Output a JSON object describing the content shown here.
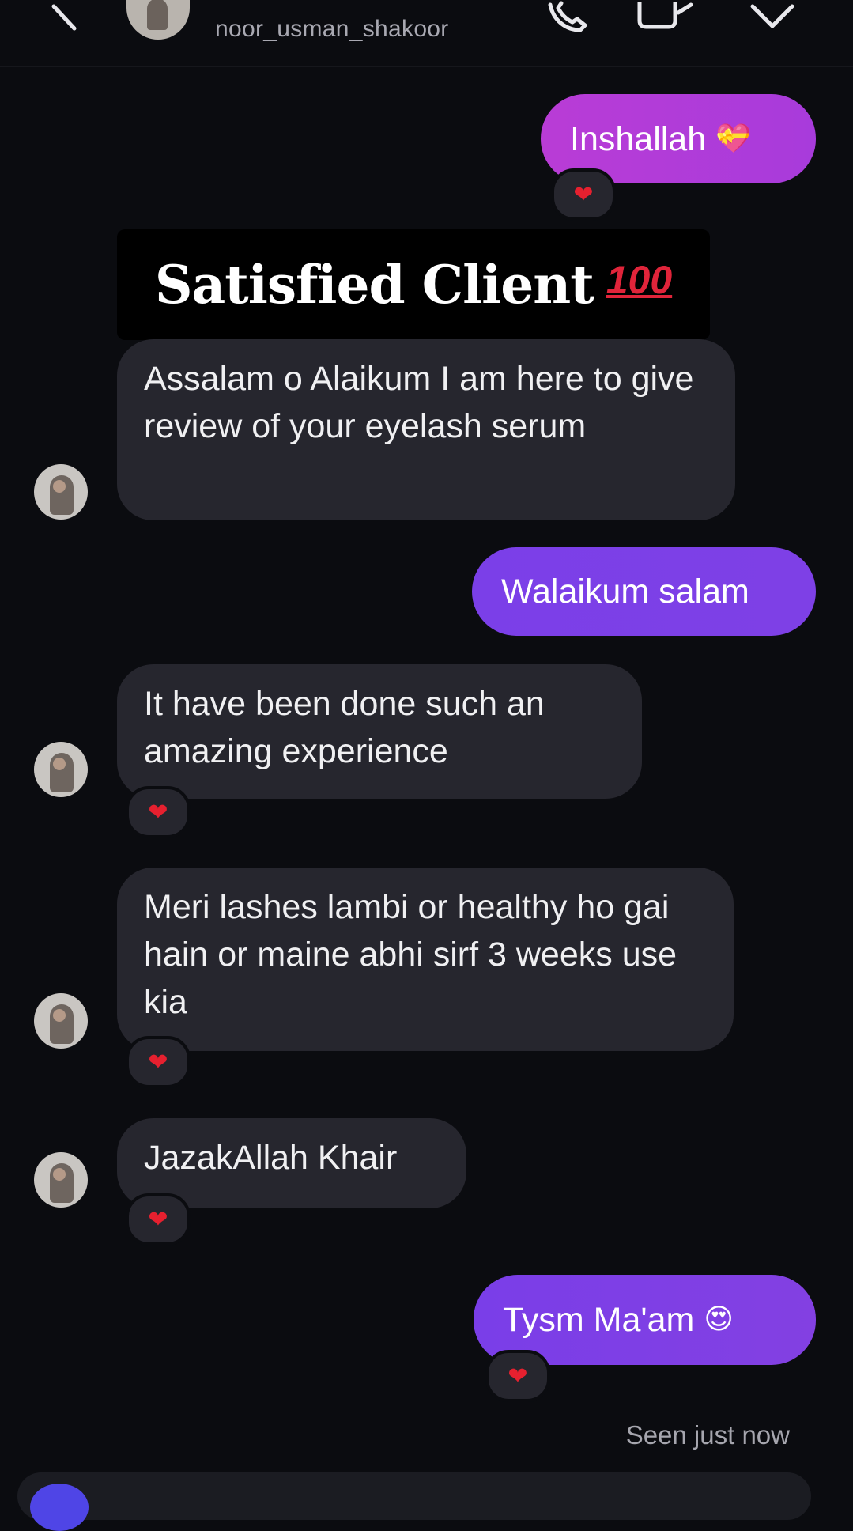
{
  "header": {
    "username": "noor_usman_shakoor",
    "icons": [
      "back-icon",
      "phone-icon",
      "video-icon",
      "chevron-down-icon"
    ]
  },
  "banner": {
    "text": "Satisfied Client",
    "emoji": "100"
  },
  "messages": [
    {
      "from": "me",
      "text": "Inshallah",
      "emoji": "💝",
      "reaction": "❤"
    },
    {
      "from": "them",
      "text": "Assalam o Alaikum I am here to give review of your eyelash serum",
      "reaction": ""
    },
    {
      "from": "me",
      "text": "Walaikum salam",
      "reaction": ""
    },
    {
      "from": "them",
      "text": "It have been done such an amazing experience",
      "reaction": "❤"
    },
    {
      "from": "them",
      "text": "Meri lashes lambi or healthy ho gai hain or maine abhi sirf 3 weeks use kia",
      "reaction": "❤"
    },
    {
      "from": "them",
      "text": "JazakAllah Khair",
      "reaction": "❤"
    },
    {
      "from": "me",
      "text": "Tysm Ma'am",
      "emoji": "😍",
      "reaction": "❤"
    }
  ],
  "status": {
    "seen": "Seen just now"
  },
  "colors": {
    "background": "#0b0c10",
    "incoming_bubble": "#26262e",
    "outgoing_magenta": "#b43ad4",
    "outgoing_violet": "#6d3fec",
    "reaction_heart": "#e6202f"
  }
}
